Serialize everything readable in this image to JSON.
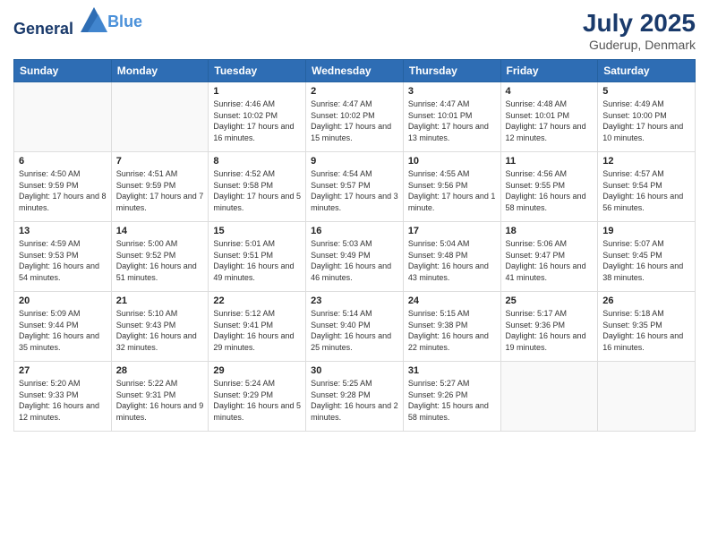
{
  "logo": {
    "line1": "General",
    "line2": "Blue"
  },
  "title": "July 2025",
  "location": "Guderup, Denmark",
  "weekdays": [
    "Sunday",
    "Monday",
    "Tuesday",
    "Wednesday",
    "Thursday",
    "Friday",
    "Saturday"
  ],
  "weeks": [
    [
      {
        "day": null
      },
      {
        "day": null
      },
      {
        "day": "1",
        "sunrise": "Sunrise: 4:46 AM",
        "sunset": "Sunset: 10:02 PM",
        "daylight": "Daylight: 17 hours and 16 minutes."
      },
      {
        "day": "2",
        "sunrise": "Sunrise: 4:47 AM",
        "sunset": "Sunset: 10:02 PM",
        "daylight": "Daylight: 17 hours and 15 minutes."
      },
      {
        "day": "3",
        "sunrise": "Sunrise: 4:47 AM",
        "sunset": "Sunset: 10:01 PM",
        "daylight": "Daylight: 17 hours and 13 minutes."
      },
      {
        "day": "4",
        "sunrise": "Sunrise: 4:48 AM",
        "sunset": "Sunset: 10:01 PM",
        "daylight": "Daylight: 17 hours and 12 minutes."
      },
      {
        "day": "5",
        "sunrise": "Sunrise: 4:49 AM",
        "sunset": "Sunset: 10:00 PM",
        "daylight": "Daylight: 17 hours and 10 minutes."
      }
    ],
    [
      {
        "day": "6",
        "sunrise": "Sunrise: 4:50 AM",
        "sunset": "Sunset: 9:59 PM",
        "daylight": "Daylight: 17 hours and 8 minutes."
      },
      {
        "day": "7",
        "sunrise": "Sunrise: 4:51 AM",
        "sunset": "Sunset: 9:59 PM",
        "daylight": "Daylight: 17 hours and 7 minutes."
      },
      {
        "day": "8",
        "sunrise": "Sunrise: 4:52 AM",
        "sunset": "Sunset: 9:58 PM",
        "daylight": "Daylight: 17 hours and 5 minutes."
      },
      {
        "day": "9",
        "sunrise": "Sunrise: 4:54 AM",
        "sunset": "Sunset: 9:57 PM",
        "daylight": "Daylight: 17 hours and 3 minutes."
      },
      {
        "day": "10",
        "sunrise": "Sunrise: 4:55 AM",
        "sunset": "Sunset: 9:56 PM",
        "daylight": "Daylight: 17 hours and 1 minute."
      },
      {
        "day": "11",
        "sunrise": "Sunrise: 4:56 AM",
        "sunset": "Sunset: 9:55 PM",
        "daylight": "Daylight: 16 hours and 58 minutes."
      },
      {
        "day": "12",
        "sunrise": "Sunrise: 4:57 AM",
        "sunset": "Sunset: 9:54 PM",
        "daylight": "Daylight: 16 hours and 56 minutes."
      }
    ],
    [
      {
        "day": "13",
        "sunrise": "Sunrise: 4:59 AM",
        "sunset": "Sunset: 9:53 PM",
        "daylight": "Daylight: 16 hours and 54 minutes."
      },
      {
        "day": "14",
        "sunrise": "Sunrise: 5:00 AM",
        "sunset": "Sunset: 9:52 PM",
        "daylight": "Daylight: 16 hours and 51 minutes."
      },
      {
        "day": "15",
        "sunrise": "Sunrise: 5:01 AM",
        "sunset": "Sunset: 9:51 PM",
        "daylight": "Daylight: 16 hours and 49 minutes."
      },
      {
        "day": "16",
        "sunrise": "Sunrise: 5:03 AM",
        "sunset": "Sunset: 9:49 PM",
        "daylight": "Daylight: 16 hours and 46 minutes."
      },
      {
        "day": "17",
        "sunrise": "Sunrise: 5:04 AM",
        "sunset": "Sunset: 9:48 PM",
        "daylight": "Daylight: 16 hours and 43 minutes."
      },
      {
        "day": "18",
        "sunrise": "Sunrise: 5:06 AM",
        "sunset": "Sunset: 9:47 PM",
        "daylight": "Daylight: 16 hours and 41 minutes."
      },
      {
        "day": "19",
        "sunrise": "Sunrise: 5:07 AM",
        "sunset": "Sunset: 9:45 PM",
        "daylight": "Daylight: 16 hours and 38 minutes."
      }
    ],
    [
      {
        "day": "20",
        "sunrise": "Sunrise: 5:09 AM",
        "sunset": "Sunset: 9:44 PM",
        "daylight": "Daylight: 16 hours and 35 minutes."
      },
      {
        "day": "21",
        "sunrise": "Sunrise: 5:10 AM",
        "sunset": "Sunset: 9:43 PM",
        "daylight": "Daylight: 16 hours and 32 minutes."
      },
      {
        "day": "22",
        "sunrise": "Sunrise: 5:12 AM",
        "sunset": "Sunset: 9:41 PM",
        "daylight": "Daylight: 16 hours and 29 minutes."
      },
      {
        "day": "23",
        "sunrise": "Sunrise: 5:14 AM",
        "sunset": "Sunset: 9:40 PM",
        "daylight": "Daylight: 16 hours and 25 minutes."
      },
      {
        "day": "24",
        "sunrise": "Sunrise: 5:15 AM",
        "sunset": "Sunset: 9:38 PM",
        "daylight": "Daylight: 16 hours and 22 minutes."
      },
      {
        "day": "25",
        "sunrise": "Sunrise: 5:17 AM",
        "sunset": "Sunset: 9:36 PM",
        "daylight": "Daylight: 16 hours and 19 minutes."
      },
      {
        "day": "26",
        "sunrise": "Sunrise: 5:18 AM",
        "sunset": "Sunset: 9:35 PM",
        "daylight": "Daylight: 16 hours and 16 minutes."
      }
    ],
    [
      {
        "day": "27",
        "sunrise": "Sunrise: 5:20 AM",
        "sunset": "Sunset: 9:33 PM",
        "daylight": "Daylight: 16 hours and 12 minutes."
      },
      {
        "day": "28",
        "sunrise": "Sunrise: 5:22 AM",
        "sunset": "Sunset: 9:31 PM",
        "daylight": "Daylight: 16 hours and 9 minutes."
      },
      {
        "day": "29",
        "sunrise": "Sunrise: 5:24 AM",
        "sunset": "Sunset: 9:29 PM",
        "daylight": "Daylight: 16 hours and 5 minutes."
      },
      {
        "day": "30",
        "sunrise": "Sunrise: 5:25 AM",
        "sunset": "Sunset: 9:28 PM",
        "daylight": "Daylight: 16 hours and 2 minutes."
      },
      {
        "day": "31",
        "sunrise": "Sunrise: 5:27 AM",
        "sunset": "Sunset: 9:26 PM",
        "daylight": "Daylight: 15 hours and 58 minutes."
      },
      {
        "day": null
      },
      {
        "day": null
      }
    ]
  ]
}
